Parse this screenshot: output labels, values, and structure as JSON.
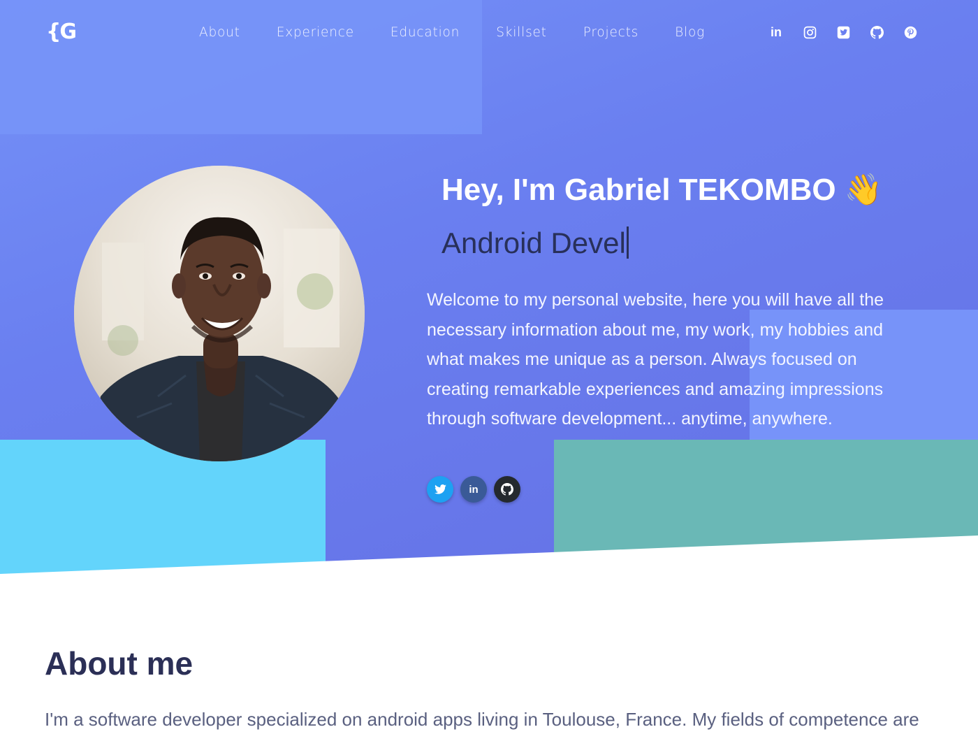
{
  "brand": {
    "logo_text": "{G"
  },
  "nav": {
    "items": [
      {
        "label": "About"
      },
      {
        "label": "Experience"
      },
      {
        "label": "Education"
      },
      {
        "label": "Skillset"
      },
      {
        "label": "Projects"
      },
      {
        "label": "Blog"
      }
    ],
    "social": [
      "linkedin-icon",
      "instagram-icon",
      "twitter-icon",
      "github-icon",
      "pinterest-icon"
    ]
  },
  "hero": {
    "greeting": "Hey, I'm Gabriel TEKOMBO",
    "wave_emoji": "👋",
    "typed_text": "Android Devel",
    "intro": "Welcome to my personal website, here you will have all the necessary information about me, my work, my hobbies and what makes me unique as a person. Always focused on creating remarkable experiences and amazing impressions through software development... anytime, anywhere.",
    "social": [
      {
        "icon": "twitter-icon",
        "color": "#1da1f2"
      },
      {
        "icon": "linkedin-icon",
        "color": "#3a5a97"
      },
      {
        "icon": "github-icon",
        "color": "#24292e"
      }
    ]
  },
  "about": {
    "title": "About me",
    "text": "I'm a software developer specialized on android apps living in Toulouse, France. My fields of competence are"
  },
  "colors": {
    "hero_gradient_start": "#7592f7",
    "hero_gradient_end": "#6470e4",
    "cyan_block": "#63d4fb",
    "teal_block": "#6ab8b6",
    "heading_dark": "#2b2f56"
  }
}
